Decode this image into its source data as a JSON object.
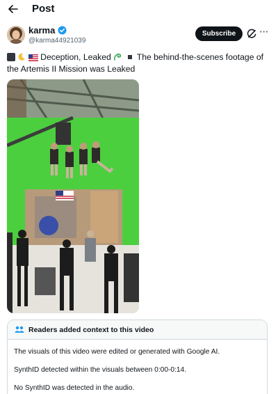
{
  "header": {
    "title": "Post",
    "back_icon": "arrow-left-icon"
  },
  "author": {
    "name": "karma",
    "handle": "@karma44921039",
    "verified_color": "#1d9bf0"
  },
  "actions": {
    "subscribe_label": "Subscribe",
    "grok_icon": "grok-icon",
    "more_label": "···"
  },
  "tweet": {
    "part1": "Deception, Leaked",
    "part2": "The behind-the-scenes footage of the Artemis II Mission was Leaked"
  },
  "media": {
    "type": "video-thumbnail",
    "icon": "video-green-screen-scene"
  },
  "community_note": {
    "title": "Readers added context to this video",
    "lines": [
      "The visuals of this video were edited or generated with Google AI.",
      "SynthID detected within the visuals between 0:00-0:14.",
      "No SynthID was detected in the audio."
    ],
    "icon": "people-icon",
    "accent": "#1d9bf0"
  }
}
